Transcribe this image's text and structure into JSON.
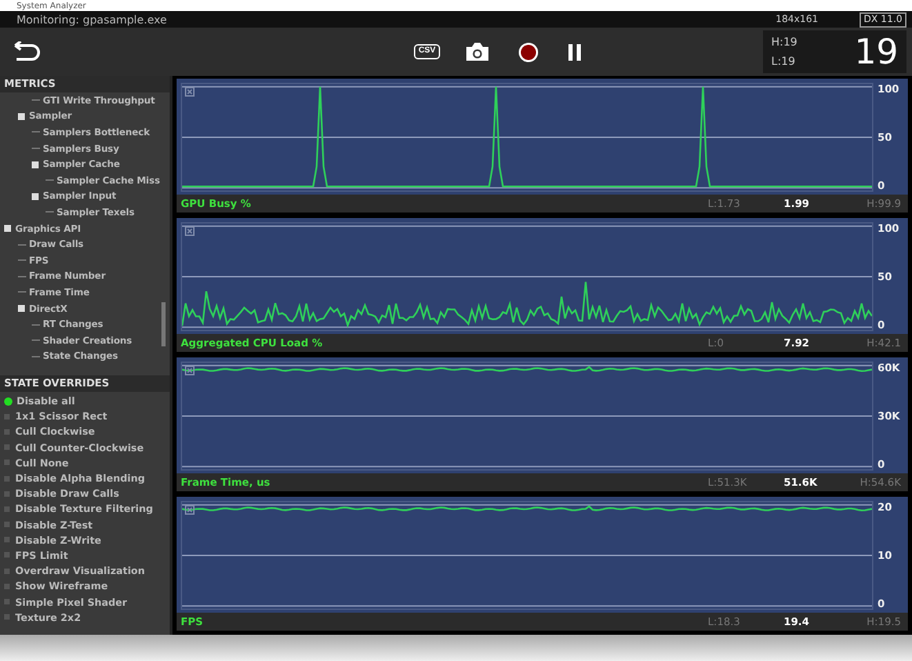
{
  "window": {
    "title": "System Analyzer"
  },
  "monitor_bar": {
    "label": "Monitoring: gpasample.exe",
    "resolution": "184x161",
    "api": "DX 11.0"
  },
  "toolbar": {
    "csv_label": "CSV",
    "recording": true,
    "fps_high": "H:19",
    "fps_low": "L:19",
    "fps": "19"
  },
  "metrics": {
    "title": "METRICS",
    "tree": [
      {
        "children": [
          {
            "children": [
              {
                "label": "GTI Write Throughput"
              }
            ]
          },
          {
            "label": "Sampler",
            "expanded": true,
            "children": [
              {
                "label": "Samplers Bottleneck"
              },
              {
                "label": "Samplers Busy"
              },
              {
                "label": "Sampler Cache",
                "expanded": true,
                "children": [
                  {
                    "label": "Sampler Cache Miss"
                  }
                ]
              },
              {
                "label": "Sampler Input",
                "expanded": true,
                "children": [
                  {
                    "label": "Sampler Texels"
                  }
                ]
              }
            ]
          }
        ]
      },
      {
        "label": "Graphics API",
        "expanded": true,
        "children": [
          {
            "label": "Draw Calls"
          },
          {
            "label": "FPS"
          },
          {
            "label": "Frame Number"
          },
          {
            "label": "Frame Time"
          },
          {
            "label": "DirectX",
            "expanded": true,
            "children": [
              {
                "label": "RT Changes"
              },
              {
                "label": "Shader Creations"
              },
              {
                "label": "State Changes"
              }
            ]
          }
        ]
      }
    ]
  },
  "state_overrides": {
    "title": "STATE OVERRIDES",
    "items": [
      {
        "label": "Disable all",
        "selected": true
      },
      {
        "label": "1x1 Scissor Rect",
        "selected": false
      },
      {
        "label": "Cull Clockwise",
        "selected": false
      },
      {
        "label": "Cull Counter-Clockwise",
        "selected": false
      },
      {
        "label": "Cull None",
        "selected": false
      },
      {
        "label": "Disable Alpha Blending",
        "selected": false
      },
      {
        "label": "Disable Draw Calls",
        "selected": false
      },
      {
        "label": "Disable Texture Filtering",
        "selected": false
      },
      {
        "label": "Disable Z-Test",
        "selected": false
      },
      {
        "label": "Disable Z-Write",
        "selected": false
      },
      {
        "label": "FPS Limit",
        "selected": false
      },
      {
        "label": "Overdraw Visualization",
        "selected": false
      },
      {
        "label": "Show Wireframe",
        "selected": false
      },
      {
        "label": "Simple Pixel Shader",
        "selected": false
      },
      {
        "label": "Texture 2x2",
        "selected": false
      }
    ]
  },
  "graphs": [
    {
      "kind": "spikes",
      "title": "GPU Busy %",
      "low": "L:1.73",
      "current": "1.99",
      "high": "H:99.9",
      "ticks": [
        "100",
        "50",
        "0"
      ]
    },
    {
      "kind": "noisy",
      "title": "Aggregated CPU Load %",
      "low": "L:0",
      "current": "7.92",
      "high": "H:42.1",
      "ticks": [
        "100",
        "50",
        "0"
      ]
    },
    {
      "kind": "flat-high",
      "title": "Frame Time, us",
      "low": "L:51.3K",
      "current": "51.6K",
      "high": "H:54.6K",
      "ticks": [
        "60K",
        "30K",
        "0"
      ]
    },
    {
      "kind": "flat-high",
      "title": "FPS",
      "low": "L:18.3",
      "current": "19.4",
      "high": "H:19.5",
      "ticks": [
        "20",
        "10",
        "0"
      ]
    }
  ]
}
